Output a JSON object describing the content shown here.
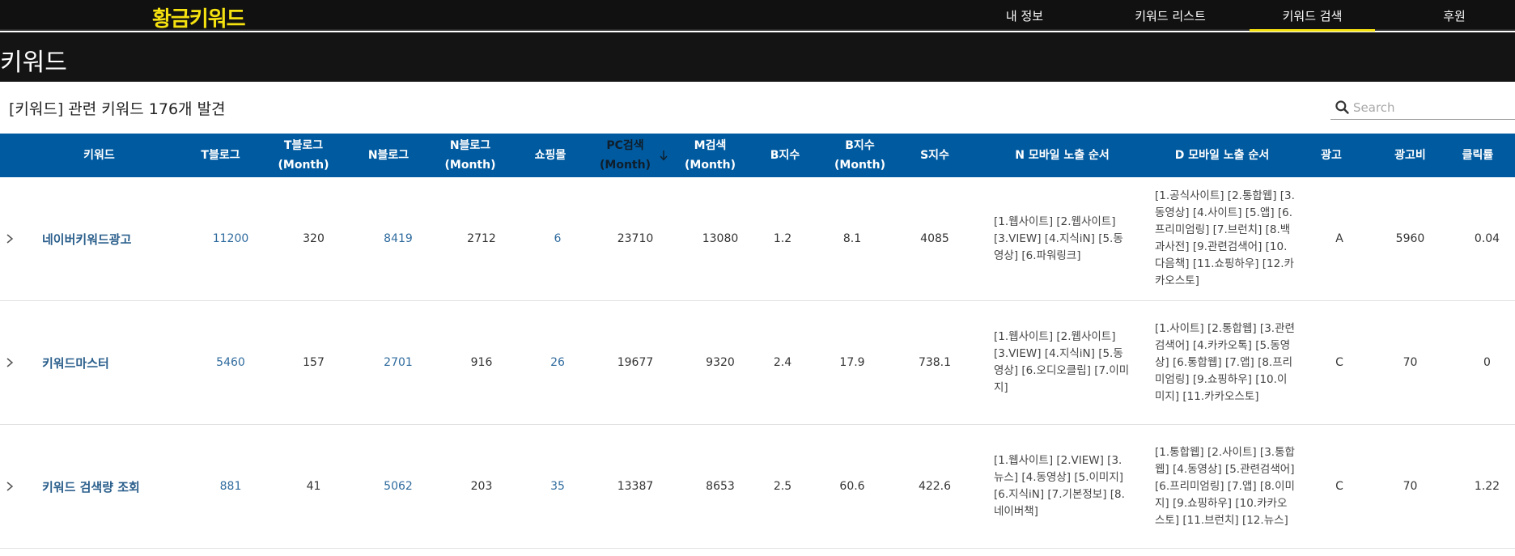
{
  "header": {
    "brand": "황금키워드",
    "nav": [
      "내 정보",
      "키워드 리스트",
      "키워드 검색",
      "후원"
    ],
    "active_nav": "키워드 검색",
    "accent": "#f5e10f"
  },
  "page": {
    "title": "키워드",
    "summary": "[키워드] 관련 키워드 176개 발견",
    "search_placeholder": "Search"
  },
  "table": {
    "header_color": "#005aa0",
    "columns": [
      "키워드",
      "T블로그",
      "T블로그\n(Month)",
      "N블로그",
      "N블로그\n(Month)",
      "쇼핑몰",
      "PC검색\n(Month)",
      "M검색\n(Month)",
      "B지수",
      "B지수\n(Month)",
      "S지수",
      "N 모바일 노출 순서",
      "D 모바일 노출 순서",
      "광고",
      "광고비",
      "클릭률"
    ],
    "sorted_column": "PC검색\n(Month)",
    "rows": [
      [
        "네이버키워드광고",
        "11200",
        "320",
        "8419",
        "2712",
        "6",
        "23710",
        "13080",
        "1.2",
        "8.1",
        "4085",
        "[1.웹사이트] [2.웹사이트] [3.VIEW] [4.지식iN] [5.동영상] [6.파워링크]",
        "[1.공식사이트] [2.통합웹] [3.동영상] [4.사이트] [5.앱] [6.프리미엄링] [7.브런치] [8.백과사전] [9.관련검색어] [10.다음책] [11.쇼핑하우] [12.카카오스토]",
        "A",
        "5960",
        "0.04"
      ],
      [
        "키워드마스터",
        "5460",
        "157",
        "2701",
        "916",
        "26",
        "19677",
        "9320",
        "2.4",
        "17.9",
        "738.1",
        "[1.웹사이트] [2.웹사이트] [3.VIEW] [4.지식iN] [5.동영상] [6.오디오클립] [7.이미지]",
        "[1.사이트] [2.통합웹] [3.관련검색어] [4.카카오톡] [5.동영상] [6.통합웹] [7.앱] [8.프리미엄링] [9.쇼핑하우] [10.이미지] [11.카카오스토]",
        "C",
        "70",
        "0"
      ],
      [
        "키워드 검색량 조회",
        "881",
        "41",
        "5062",
        "203",
        "35",
        "13387",
        "8653",
        "2.5",
        "60.6",
        "422.6",
        "[1.웹사이트] [2.VIEW] [3.뉴스] [4.동영상] [5.이미지] [6.지식iN] [7.기본정보] [8.네이버책]",
        "[1.통합웹] [2.사이트] [3.통합웹] [4.동영상] [5.관련검색어] [6.프리미엄링] [7.앱] [8.이미지] [9.쇼핑하우] [10.카카오스토] [11.브런치] [12.뉴스]",
        "C",
        "70",
        "1.22"
      ]
    ]
  }
}
